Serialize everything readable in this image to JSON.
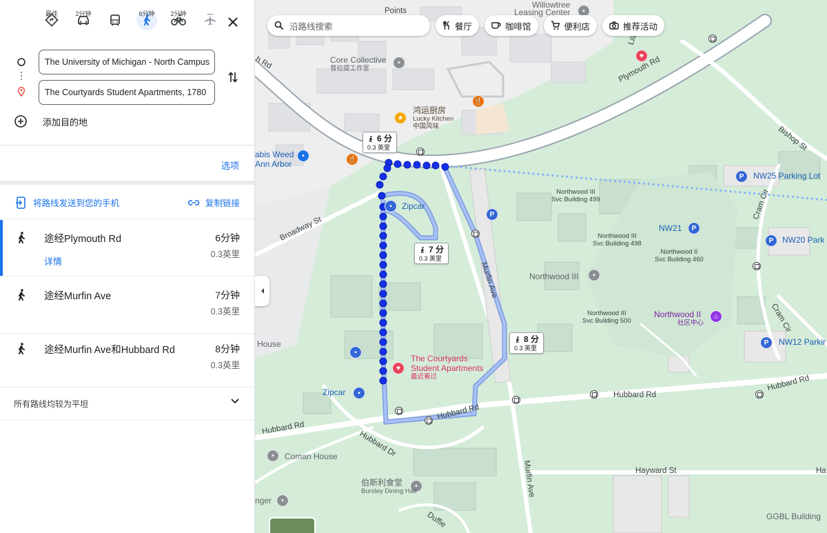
{
  "modes": [
    {
      "id": "best",
      "label": "最佳",
      "icon": "directions-icon"
    },
    {
      "id": "drive",
      "label": "2分钟",
      "icon": "car-icon"
    },
    {
      "id": "transit",
      "label": "",
      "icon": "bus-icon"
    },
    {
      "id": "walk",
      "label": "6分钟",
      "icon": "walk-icon",
      "active": true
    },
    {
      "id": "bike",
      "label": "2分钟",
      "icon": "bicycle-icon"
    },
    {
      "id": "flight",
      "label": "—",
      "icon": "airplane-icon"
    }
  ],
  "origin": "The University of Michigan - North Campus",
  "destination": "The Courtyards Student Apartments, 1780",
  "add_destination": "添加目的地",
  "options_link": "选项",
  "send_to_phone": "将路线发送到您的手机",
  "copy_link": "复制链接",
  "routes": [
    {
      "name": "途经Plymouth Rd",
      "time": "6分钟",
      "distance": "0.3英里",
      "details": "详情",
      "selected": true
    },
    {
      "name": "途经Murfin Ave",
      "time": "7分钟",
      "distance": "0.3英里"
    },
    {
      "name": "途经Murfin Ave和Hubbard Rd",
      "time": "8分钟",
      "distance": "0.3英里"
    }
  ],
  "flat_note": "所有路线均较为平坦",
  "map": {
    "search_placeholder": "沿路线搜索",
    "chips": [
      {
        "label": "餐厅",
        "icon": "fork-knife-icon"
      },
      {
        "label": "咖啡馆",
        "icon": "coffee-icon"
      },
      {
        "label": "便利店",
        "icon": "cart-icon"
      },
      {
        "label": "推荐活动",
        "icon": "camera-icon"
      }
    ],
    "callouts": [
      {
        "time": "6 分",
        "dist": "0.3 英里"
      },
      {
        "time": "7 分",
        "dist": "0.3 英里"
      },
      {
        "time": "8 分",
        "dist": "0.3 英里"
      }
    ],
    "labels": {
      "willowtree": "Willowtree",
      "leasing": "Leasing Center",
      "core_collective": "Core Collective",
      "core_collective_cn": "普拉提工作室",
      "lucky_cn": "鸿运厨房",
      "lucky": "Lucky Kitchen",
      "lucky_sub": "中国风味",
      "cabis": "abis Weed",
      "ann_arbor": "Ann Arbor",
      "zipcar1": "Zipcar",
      "zipcar2": "Zipcar",
      "broadway": "Broadway St",
      "plymouth": "Plymouth Rd",
      "rd_left": "h Rd",
      "bishop": "Bishop St",
      "nw25": "NW25 Parking Lot",
      "cram": "Cram Cir",
      "cram2": "Cram Cir",
      "nw499_1": "Northwood III",
      "nw499_2": "Svc Building 499",
      "nw21": "NW21",
      "nw20": "NW20 Park",
      "nw498_1": "Northwood III",
      "nw498_2": "Svc Building 498",
      "nw460_1": "Northwood II",
      "nw460_2": "Svc Building 460",
      "northwood3": "Northwood III",
      "nw500_1": "Northwood III",
      "nw500_2": "Svc Building 500",
      "northwood2": "Northwood II",
      "northwood2_cn": "社区中心",
      "nw12": "NW12 Parkir",
      "murfin": "Murfin Ave",
      "murfin2": "Murfin Ave",
      "house": "House",
      "courtyards1": "The Courtyards",
      "courtyards2": "Student Apartments",
      "courtyards_cn": "最近看过",
      "hubbard_rd1": "Hubbard Rd",
      "hubbard_rd2": "Hubbard Rd",
      "hubbard_rd3": "Hubbard Rd",
      "hubbard_rd4": "Hubbard Rd",
      "hubbard_dr": "Hubbard Dr",
      "coman": "Coman House",
      "bursley_cn": "伯斯利食堂",
      "bursley": "Bursley Dining Hall",
      "hayward": "Hayward St",
      "ha": "Ha",
      "unger": "nger",
      "duffield": "Duffie",
      "ggbl": "GGBL Building",
      "points": "Points",
      "lila": "Lila"
    }
  }
}
